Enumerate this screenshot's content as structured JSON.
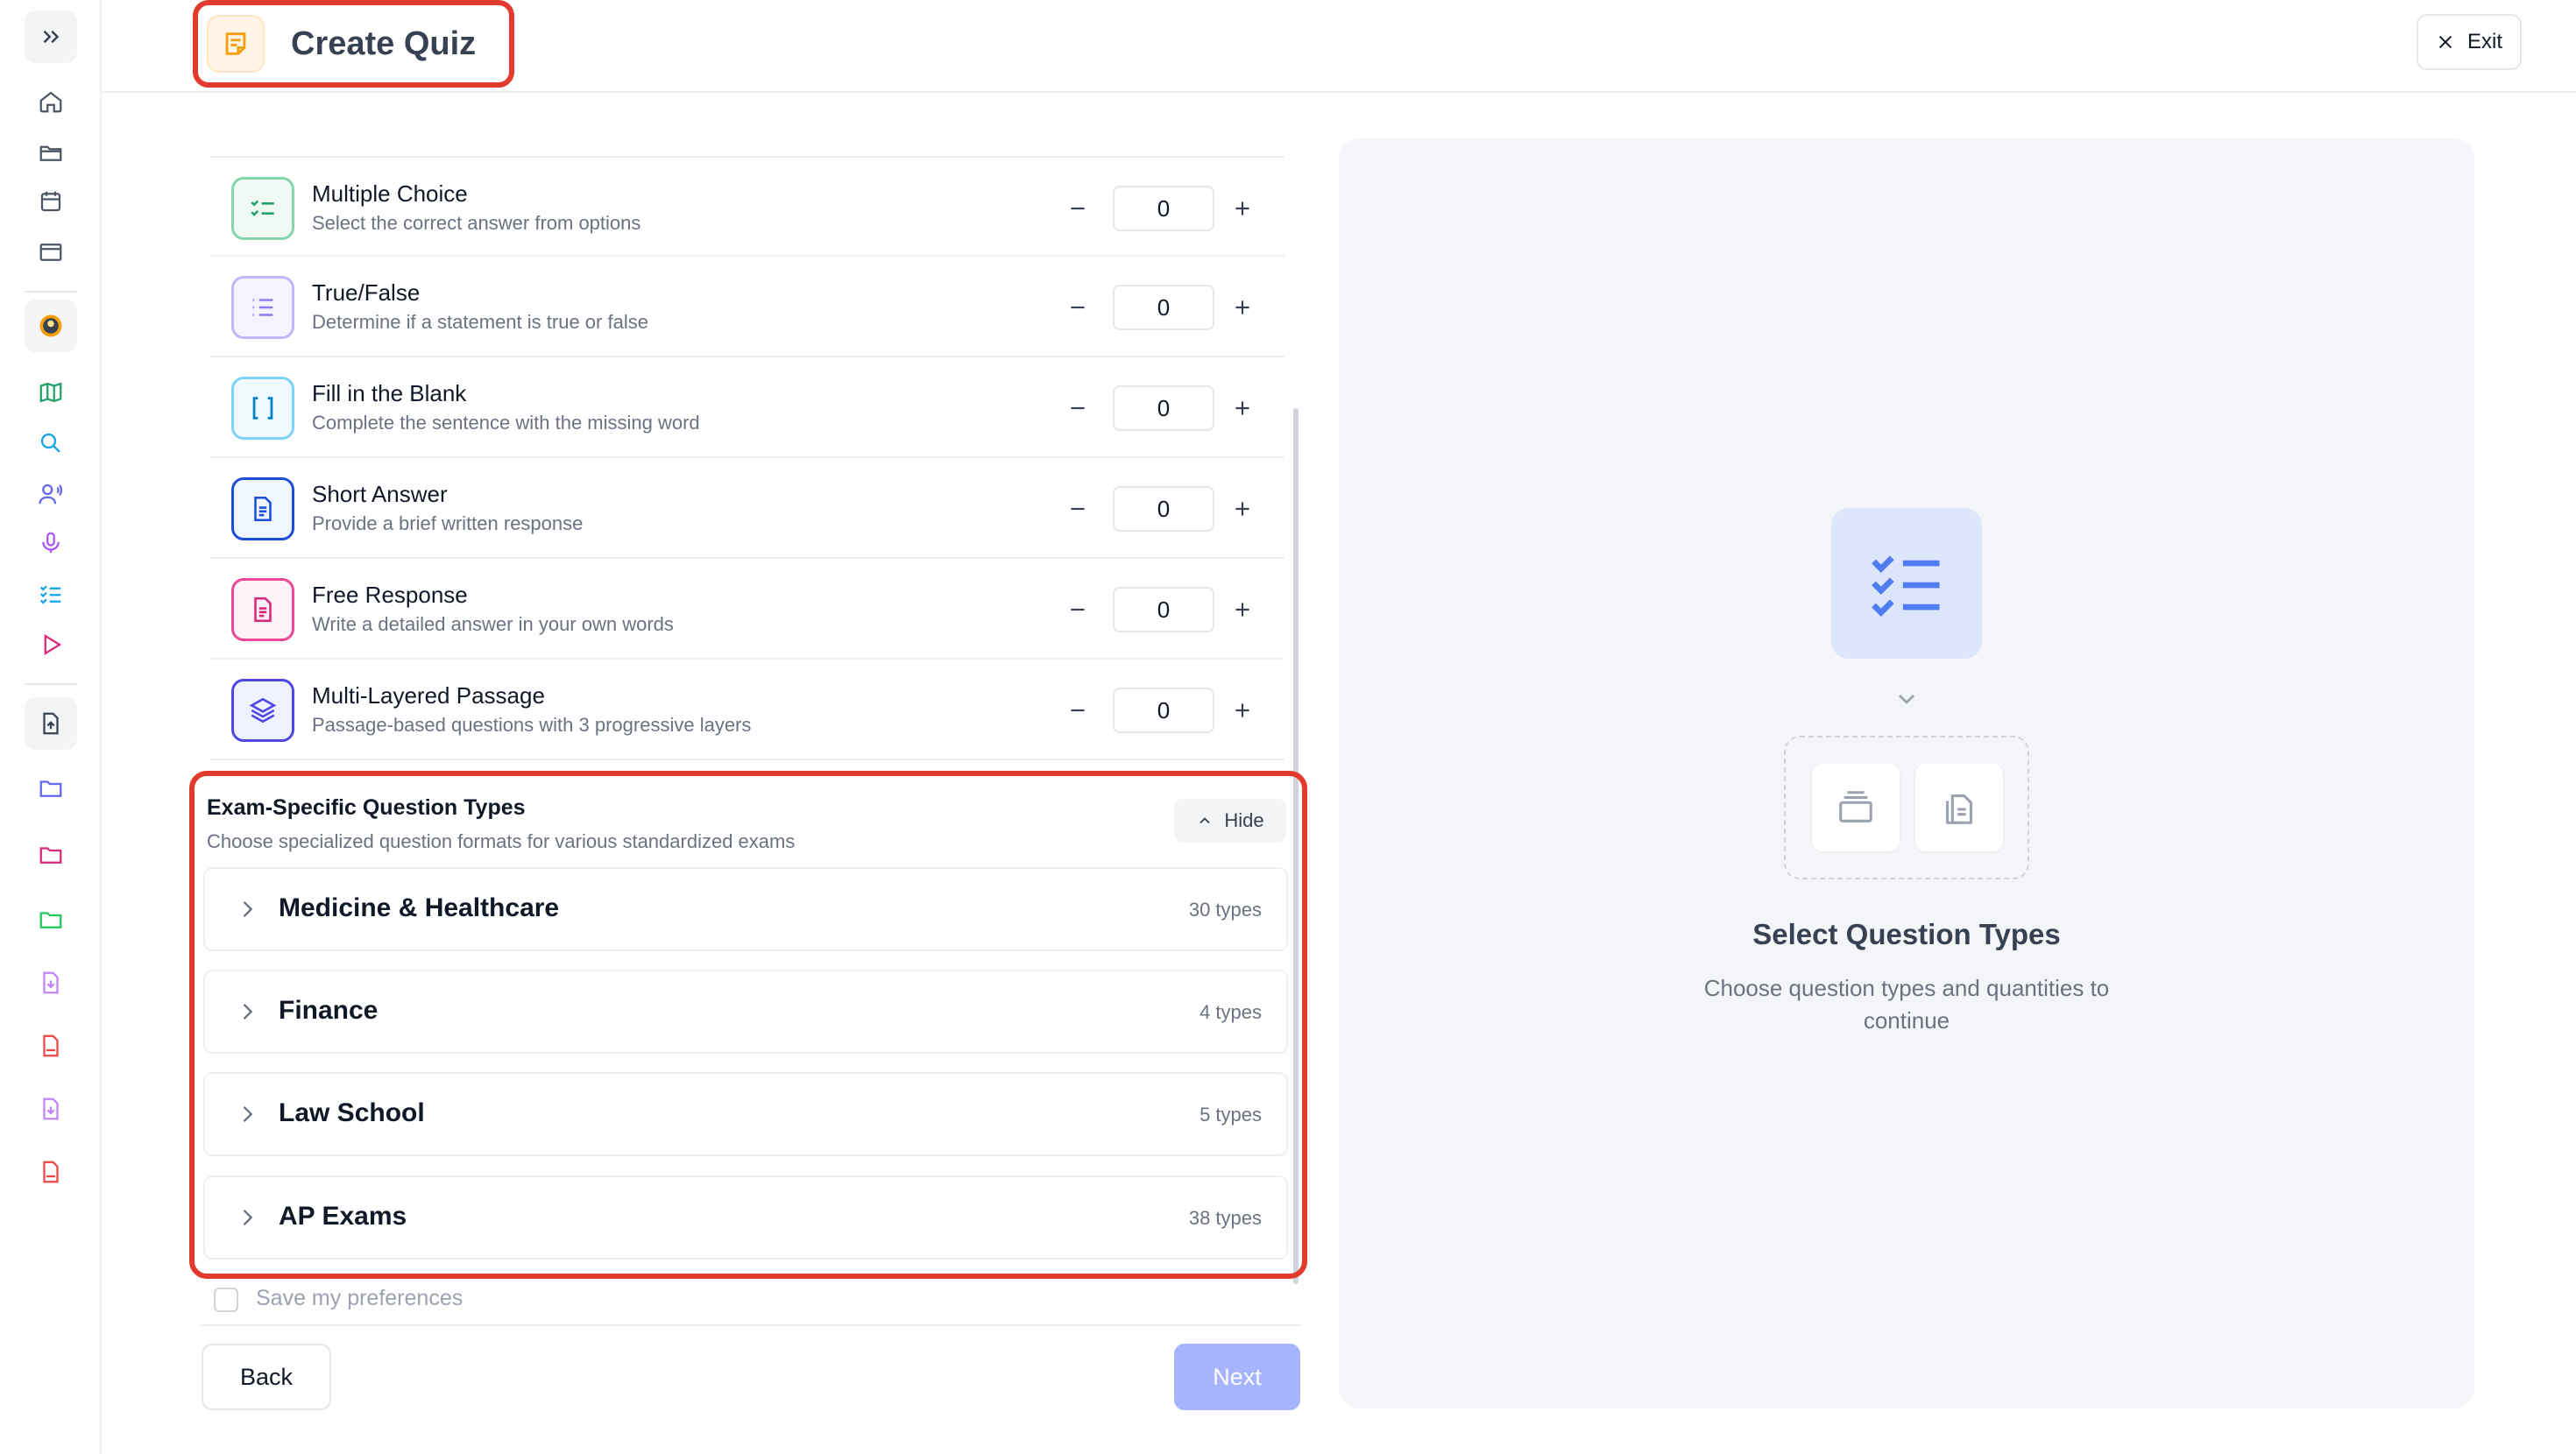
{
  "header": {
    "title": "Create Quiz",
    "exit_label": "Exit"
  },
  "sidebar": {
    "items": [
      {
        "icon": "expand-sidebar-icon"
      },
      {
        "icon": "home-icon"
      },
      {
        "icon": "folder-open-icon"
      },
      {
        "icon": "calendar-icon"
      },
      {
        "icon": "window-icon"
      },
      {
        "icon": "avatar-icon"
      },
      {
        "icon": "map-icon"
      },
      {
        "icon": "chat-icon"
      },
      {
        "icon": "voice-icon"
      },
      {
        "icon": "microphone-icon"
      },
      {
        "icon": "checklist-icon"
      },
      {
        "icon": "play-icon"
      },
      {
        "icon": "upload-file-icon"
      },
      {
        "icon": "folder-icon"
      },
      {
        "icon": "folder-pink-icon"
      },
      {
        "icon": "folder-green-icon"
      },
      {
        "icon": "document-download-icon"
      },
      {
        "icon": "pdf-icon"
      },
      {
        "icon": "document-download-icon"
      },
      {
        "icon": "pdf-icon"
      }
    ]
  },
  "question_types": [
    {
      "name": "Multiple Choice",
      "desc": "Select the correct answer from options",
      "count": "0",
      "icon": "checklist-icon",
      "color": "#22a06b"
    },
    {
      "name": "True/False",
      "desc": "Determine if a statement is true or false",
      "count": "0",
      "icon": "list-icon",
      "color": "#8b7cf6"
    },
    {
      "name": "Fill in the Blank",
      "desc": "Complete the sentence with the missing word",
      "count": "0",
      "icon": "brackets-icon",
      "color": "#0ea5e9"
    },
    {
      "name": "Short Answer",
      "desc": "Provide a brief written response",
      "count": "0",
      "icon": "document-icon",
      "color": "#1d4ed8"
    },
    {
      "name": "Free Response",
      "desc": "Write a detailed answer in your own words",
      "count": "0",
      "icon": "document-text-icon",
      "color": "#db2777"
    },
    {
      "name": "Multi-Layered Passage",
      "desc": "Passage-based questions with 3 progressive layers",
      "count": "0",
      "icon": "layers-icon",
      "color": "#4f46e5"
    }
  ],
  "exam_section": {
    "title": "Exam-Specific Question Types",
    "subtitle": "Choose specialized question formats for various standardized exams",
    "hide_label": "Hide",
    "categories": [
      {
        "name": "Medicine & Healthcare",
        "count": "30 types"
      },
      {
        "name": "Finance",
        "count": "4 types"
      },
      {
        "name": "Law School",
        "count": "5 types"
      },
      {
        "name": "AP Exams",
        "count": "38 types"
      }
    ]
  },
  "footer": {
    "save_pref_label": "Save my preferences",
    "back_label": "Back",
    "next_label": "Next"
  },
  "right_panel": {
    "title": "Select Question Types",
    "subtitle": "Choose question types and quantities to continue"
  },
  "colors": {
    "accent": "#a5b4fc",
    "highlight": "#e23a2c",
    "panel_bg": "#f3f5f9"
  }
}
